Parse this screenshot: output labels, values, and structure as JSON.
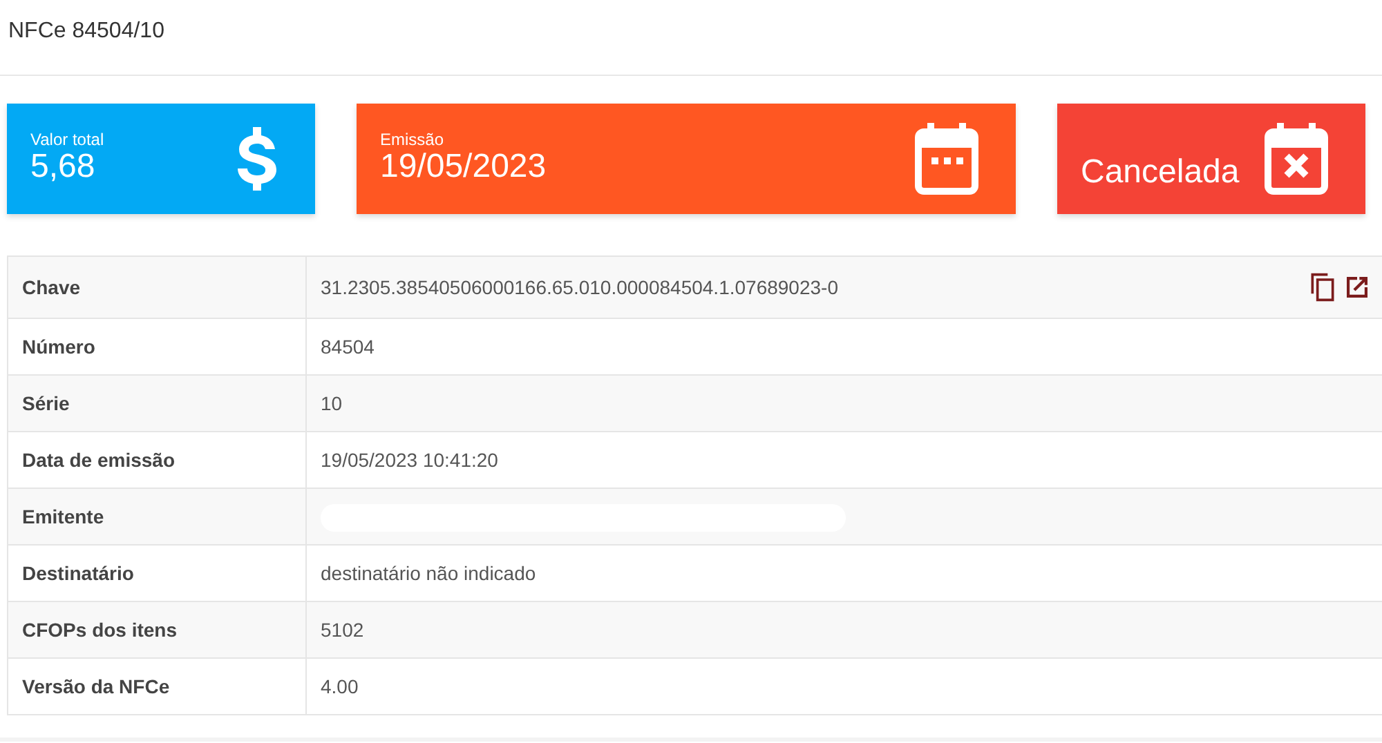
{
  "title": "NFCe 84504/10",
  "cards": [
    {
      "label": "Valor total",
      "value": "5,68",
      "kind": "money",
      "color": "#03a9f4"
    },
    {
      "label": "Emissão",
      "value": "19/05/2023",
      "kind": "date",
      "color": "#ff5722"
    },
    {
      "value": "Cancelada",
      "kind": "status",
      "color": "#f44336"
    }
  ],
  "rows": [
    {
      "label": "Chave",
      "value": "31.2305.38540506000166.65.010.000084504.1.07689023-0",
      "kind": "key"
    },
    {
      "label": "Número",
      "value": "84504",
      "kind": "text"
    },
    {
      "label": "Série",
      "value": "10",
      "kind": "text"
    },
    {
      "label": "Data de emissão",
      "value": "19/05/2023 10:41:20",
      "kind": "text"
    },
    {
      "label": "Emitente",
      "kind": "hidden"
    },
    {
      "label": "Destinatário",
      "value": "destinatário não indicado",
      "kind": "text"
    },
    {
      "label": "CFOPs dos itens",
      "value": "5102",
      "kind": "text"
    },
    {
      "label": "Versão da NFCe",
      "value": "4.00",
      "kind": "text"
    }
  ]
}
